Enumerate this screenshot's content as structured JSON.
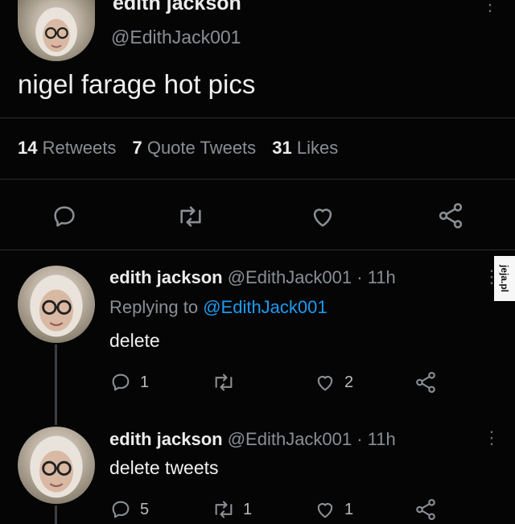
{
  "main_tweet": {
    "display_name": "edith jackson",
    "handle": "@EdithJack001",
    "text": "nigel farage hot pics",
    "stats": {
      "retweets_count": "14",
      "retweets_label": "Retweets",
      "quotes_count": "7",
      "quotes_label": "Quote Tweets",
      "likes_count": "31",
      "likes_label": "Likes"
    }
  },
  "replies": [
    {
      "display_name": "edith jackson",
      "meta": "@EdithJack001 · 11h",
      "replying_prefix": "Replying to",
      "replying_handle": "@EdithJack001",
      "text": "delete",
      "reply_count": "1",
      "retweet_count": "",
      "like_count": "2"
    },
    {
      "display_name": "edith jackson",
      "meta": "@EdithJack001 · 11h",
      "text": "delete tweets",
      "reply_count": "5",
      "retweet_count": "1",
      "like_count": "1"
    }
  ],
  "watermark": "jeja.pl",
  "icons": [
    "reply-icon",
    "retweet-icon",
    "like-icon",
    "share-icon",
    "more-icon"
  ]
}
